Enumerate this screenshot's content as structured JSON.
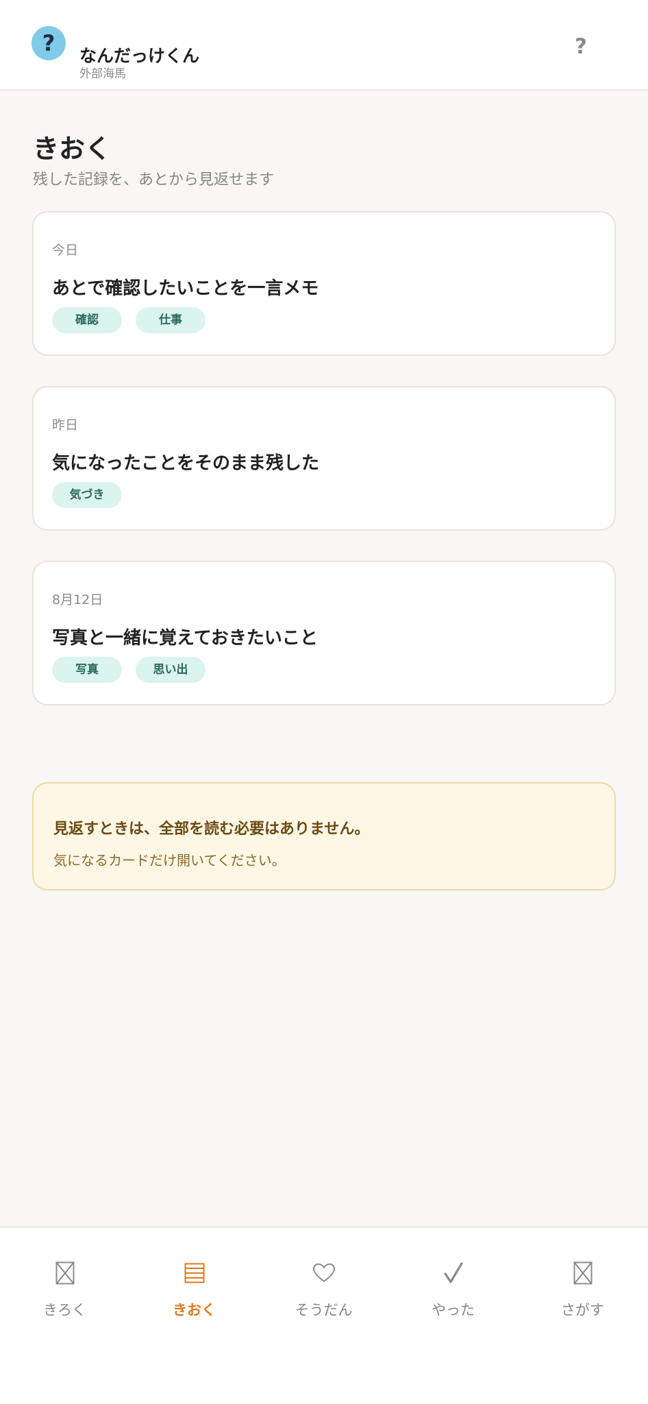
{
  "header": {
    "logo_glyph": "?",
    "app_name": "なんだっけくん",
    "app_subtitle": "外部海馬",
    "help_glyph": "?"
  },
  "page": {
    "title": "きおく",
    "subtitle": "残した記録を、あとから見返せます"
  },
  "cards": [
    {
      "date": "今日",
      "text": "あとで確認したいことを一言メモ",
      "tags": [
        "確認",
        "仕事"
      ]
    },
    {
      "date": "昨日",
      "text": "気になったことをそのまま残した",
      "tags": [
        "気づき"
      ]
    },
    {
      "date": "8月12日",
      "text": "写真と一緒に覚えておきたいこと",
      "tags": [
        "写真",
        "思い出"
      ]
    }
  ],
  "tip": {
    "title": "見返すときは、全部を読む必要はありません。",
    "body": "気になるカードだけ開いてください。"
  },
  "nav": {
    "items": [
      {
        "label": "きろく",
        "icon": "image-placeholder-icon",
        "active": false
      },
      {
        "label": "きおく",
        "icon": "list-icon",
        "active": true
      },
      {
        "label": "そうだん",
        "icon": "heart-icon",
        "active": false
      },
      {
        "label": "やった",
        "icon": "check-icon",
        "active": false
      },
      {
        "label": "さがす",
        "icon": "image-placeholder-icon",
        "active": false
      }
    ]
  },
  "colors": {
    "accent": "#e07820",
    "logo_bg": "#7fcbe8",
    "tag_bg": "#dcf4ee",
    "tag_text": "#2a6a5e",
    "tip_bg": "#fff7e6",
    "tip_border": "#ecdba8"
  }
}
